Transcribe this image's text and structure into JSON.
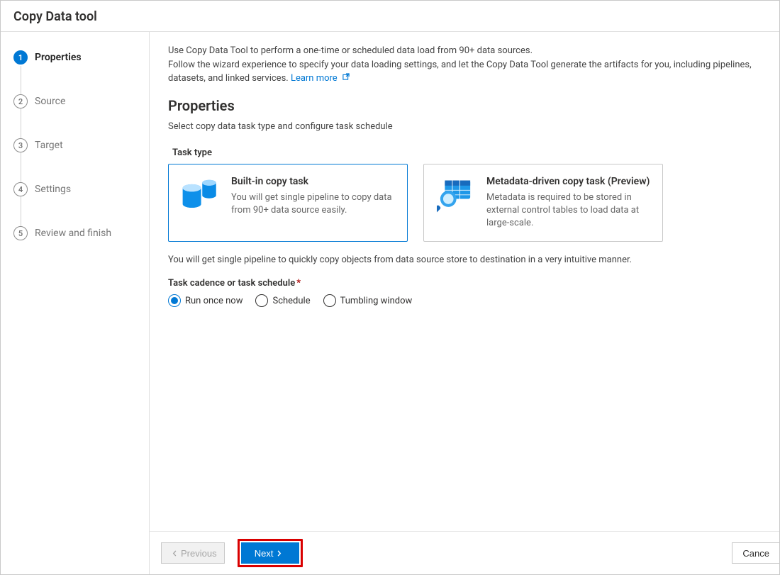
{
  "header": {
    "title": "Copy Data tool"
  },
  "sidebar": {
    "steps": [
      {
        "num": "1",
        "label": "Properties",
        "active": true
      },
      {
        "num": "2",
        "label": "Source"
      },
      {
        "num": "3",
        "label": "Target"
      },
      {
        "num": "4",
        "label": "Settings"
      },
      {
        "num": "5",
        "label": "Review and finish"
      }
    ]
  },
  "main": {
    "intro_line1": "Use Copy Data Tool to perform a one-time or scheduled data load from 90+ data sources.",
    "intro_line2": "Follow the wizard experience to specify your data loading settings, and let the Copy Data Tool generate the artifacts for you, including pipelines, datasets, and linked services. ",
    "learn_more_label": "Learn more",
    "section_title": "Properties",
    "section_desc": "Select copy data task type and configure task schedule",
    "task_type_label": "Task type",
    "cards": {
      "builtin": {
        "title": "Built-in copy task",
        "desc": "You will get single pipeline to copy data from 90+ data source easily."
      },
      "metadata": {
        "title": "Metadata-driven copy task (Preview)",
        "desc": "Metadata is required to be stored in external control tables to load data at large-scale."
      }
    },
    "task_type_note": "You will get single pipeline to quickly copy objects from data source store to destination in a very intuitive manner.",
    "schedule_label": "Task cadence or task schedule",
    "radios": {
      "run_once": "Run once now",
      "schedule": "Schedule",
      "tumbling": "Tumbling window"
    }
  },
  "footer": {
    "previous_label": "Previous",
    "next_label": "Next",
    "cancel_label": "Cance"
  }
}
